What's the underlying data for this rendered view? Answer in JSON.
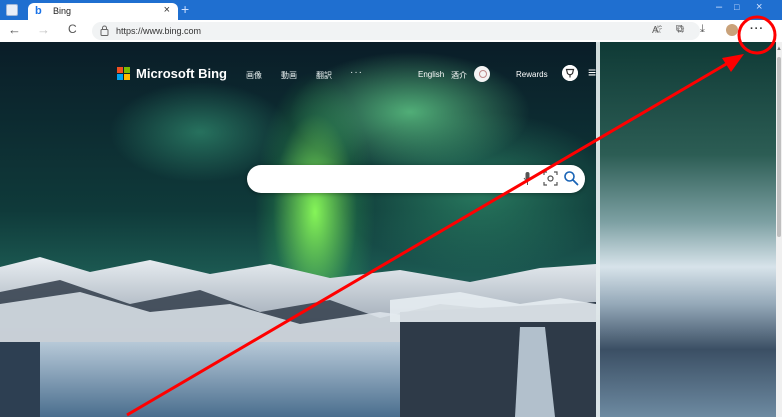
{
  "browser": {
    "tab_title": "Bing",
    "tab_favicon": "b",
    "tab_close": "×",
    "new_tab": "+",
    "url": "https://www.bing.com",
    "more_menu": "···",
    "window_min": "–",
    "window_max": "□",
    "window_close": "×",
    "nav_back": "←",
    "nav_forward": "→",
    "nav_refresh": "C",
    "read_aloud": "Aˆ",
    "favorites_add": "☆",
    "favorites": "☆",
    "collections": "⧉",
    "download": "⤓"
  },
  "bing": {
    "brand": "Microsoft Bing",
    "nav": [
      {
        "label": "画像"
      },
      {
        "label": "動画"
      },
      {
        "label": "翻訳"
      }
    ],
    "nav_more": "···",
    "language": "English",
    "user_name": "酒介",
    "rewards": "Rewards",
    "menu": "≡"
  },
  "colors": {
    "tabbar": "#1f6fd0",
    "annotation": "#ff0000",
    "logo": [
      "#f25022",
      "#7fba00",
      "#00a4ef",
      "#ffb900"
    ]
  },
  "icons": {
    "lock": "lock-icon",
    "mic": "microphone-icon",
    "visual_search": "visual-search-icon",
    "search": "search-icon",
    "more": "ellipsis-icon"
  }
}
